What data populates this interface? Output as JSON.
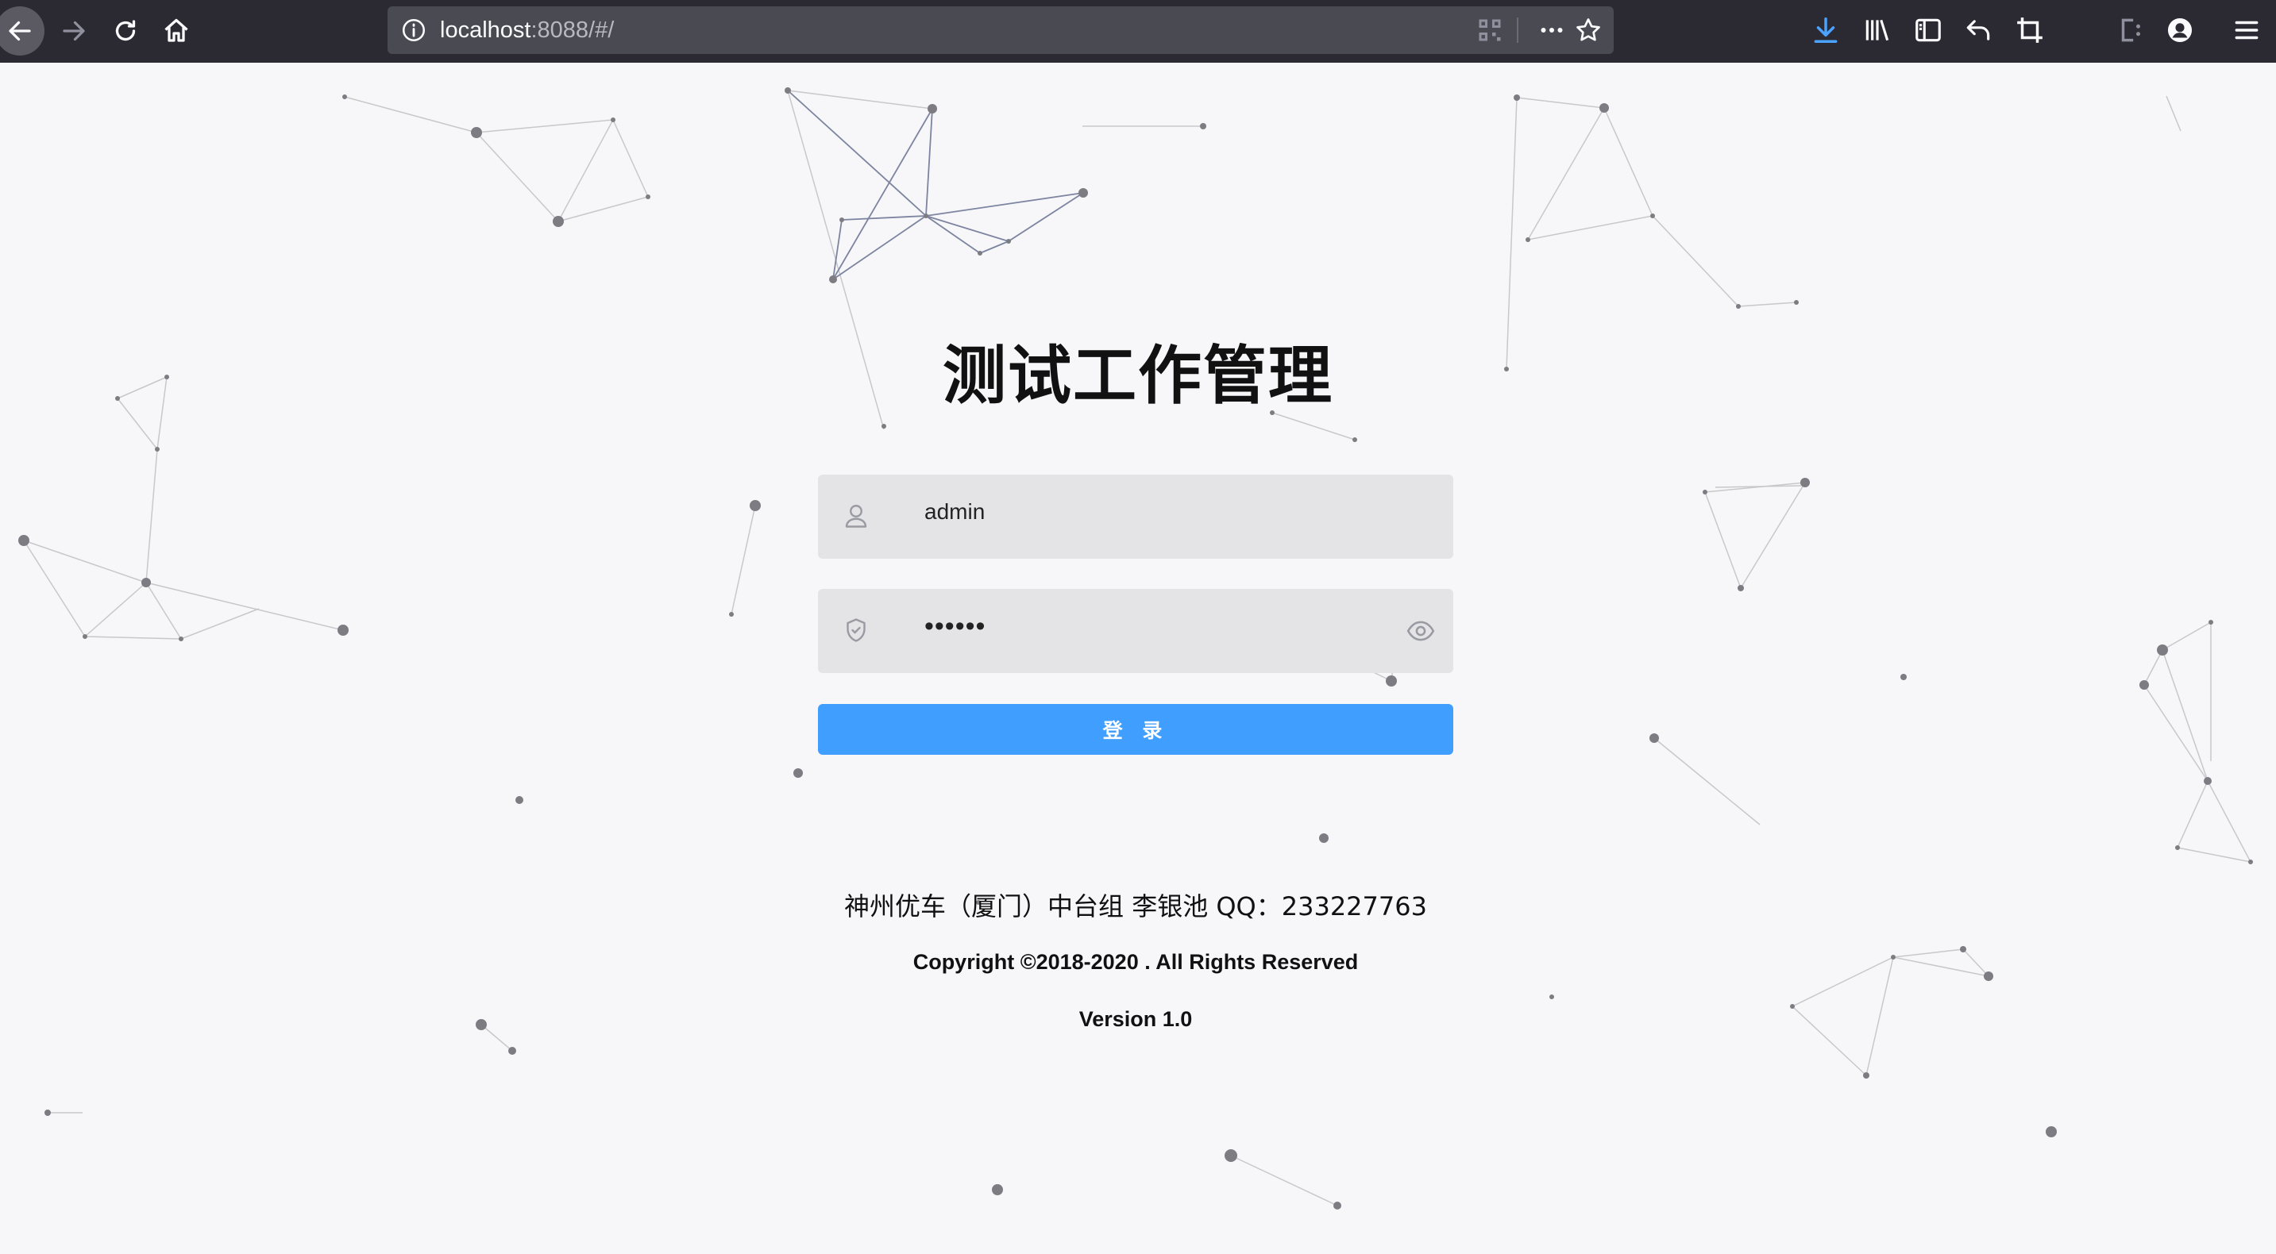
{
  "browser": {
    "url_host": "localhost",
    "url_rest": ":8088/#/"
  },
  "toolbar_icons": [
    "back-icon",
    "forward-icon",
    "reload-icon",
    "home-icon",
    "info-icon",
    "qr-code-icon",
    "more-icon",
    "bookmark-star-icon",
    "download-icon",
    "library-icon",
    "sidebar-icon",
    "undo-icon",
    "crop-icon",
    "extension-icon",
    "account-icon",
    "menu-icon"
  ],
  "login": {
    "title": "测试工作管理",
    "username_value": "admin",
    "password_value": "••••••",
    "submit_label": "登 录",
    "team_line": "神州优车（厦门）中台组 李银池 QQ：233227763",
    "copyright": "Copyright ©2018-2020 . All Rights Reserved",
    "version": "Version 1.0"
  },
  "colors": {
    "button": "#409eff",
    "field_bg": "#e4e4e6",
    "page_bg": "#f7f7f9",
    "chrome_bg": "#2b2a33",
    "download_icon": "#4aa3ff"
  }
}
